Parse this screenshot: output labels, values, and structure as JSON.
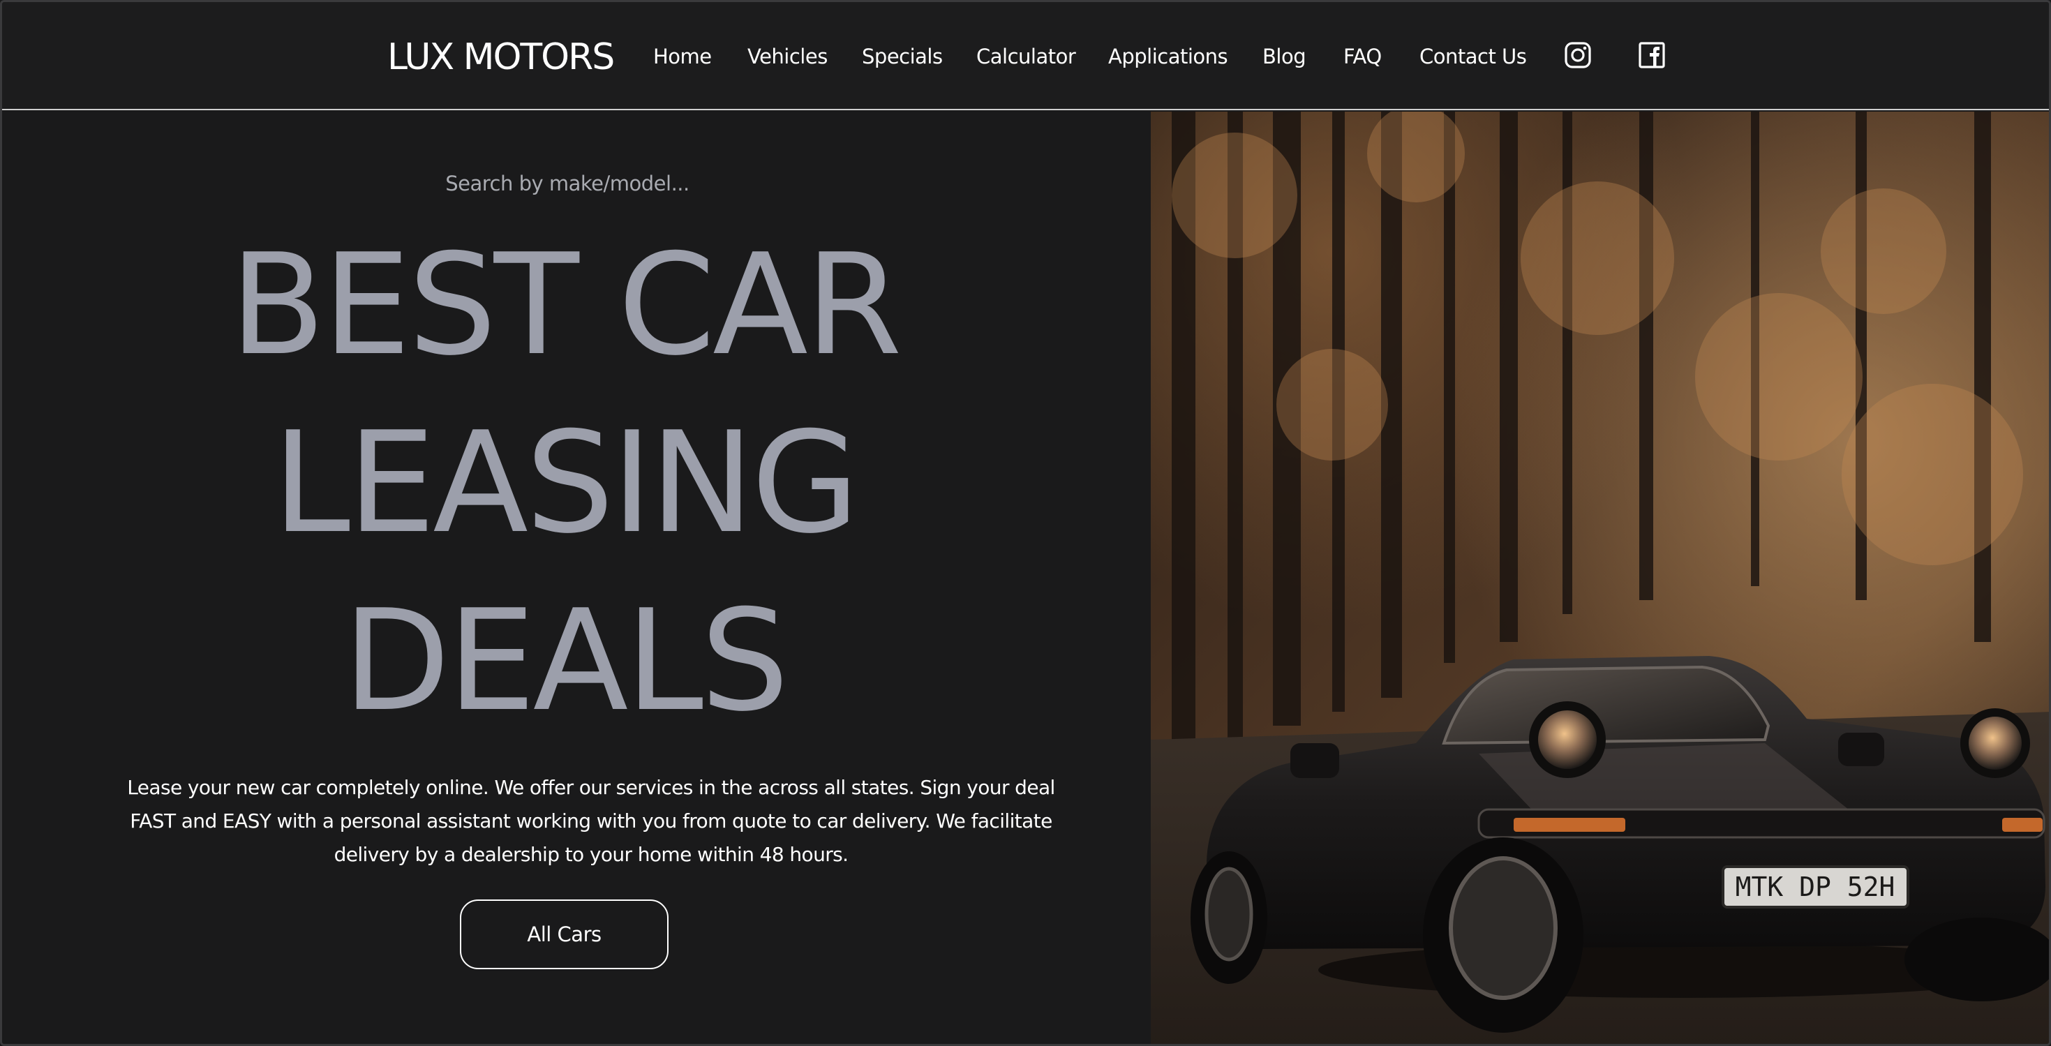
{
  "brand": {
    "name": "LUX MOTORS"
  },
  "nav": {
    "items": [
      {
        "label": "Home"
      },
      {
        "label": "Vehicles"
      },
      {
        "label": "Specials"
      },
      {
        "label": "Calculator"
      },
      {
        "label": "Applications"
      },
      {
        "label": "Blog"
      },
      {
        "label": "FAQ"
      },
      {
        "label": "Contact Us"
      }
    ],
    "social": [
      {
        "icon": "instagram-icon"
      },
      {
        "icon": "facebook-icon"
      }
    ]
  },
  "hero": {
    "search_placeholder": "Search by make/model...",
    "headline": [
      "BEST CAR",
      "LEASING",
      "DEALS"
    ],
    "description_lines": [
      "Lease your new car completely online. We offer our services in the across all states. Sign your deal",
      "FAST and EASY with a personal assistant working with you from quote to car delivery. We facilitate",
      "delivery by a dealership to your home within 48 hours."
    ],
    "cta_label": "All Cars",
    "image": {
      "plate_text": "MTK DP 52H"
    }
  },
  "colors": {
    "background": "#1a1a1b",
    "headline": "#9c9fab",
    "text": "#ffffff"
  }
}
